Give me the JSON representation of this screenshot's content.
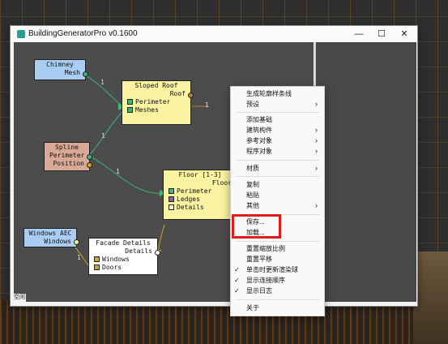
{
  "window": {
    "title": "BuildingGeneratorPro v0.1600",
    "minimize": "—",
    "maximize": "☐",
    "close": "✕"
  },
  "status": "空闲",
  "nodes": {
    "chimney": {
      "title": "Chimney",
      "out": "Mesh"
    },
    "sloped_roof": {
      "title": "Sloped Roof",
      "out": "Roof",
      "in1": "Perimeter",
      "in2": "Meshes"
    },
    "spline": {
      "title": "Spline",
      "out1": "Perimeter",
      "out2": "Position"
    },
    "floor": {
      "title": "Floor [1-3]",
      "out": "Floor",
      "in1": "Perimeter",
      "in2": "Ledges",
      "in3": "Details"
    },
    "windows_aec": {
      "title": "Windows AEC",
      "out": "Windows"
    },
    "facade": {
      "title": "Facade Details",
      "out": "Details",
      "in1": "Windows",
      "in2": "Doors"
    }
  },
  "edge_labels": [
    "1",
    "1",
    "1",
    "1",
    "1"
  ],
  "context_menu": {
    "items": [
      "生成轮廓样条线",
      "预设",
      "添加基础",
      "建筑构件",
      "参考对象",
      "程序对象",
      "材质",
      "复制",
      "粘贴",
      "其他",
      "保存...",
      "加载...",
      "重置缩放比例",
      "重置平移",
      "单击时更新渲染球",
      "显示连接顺序",
      "显示日志",
      "关于"
    ]
  }
}
